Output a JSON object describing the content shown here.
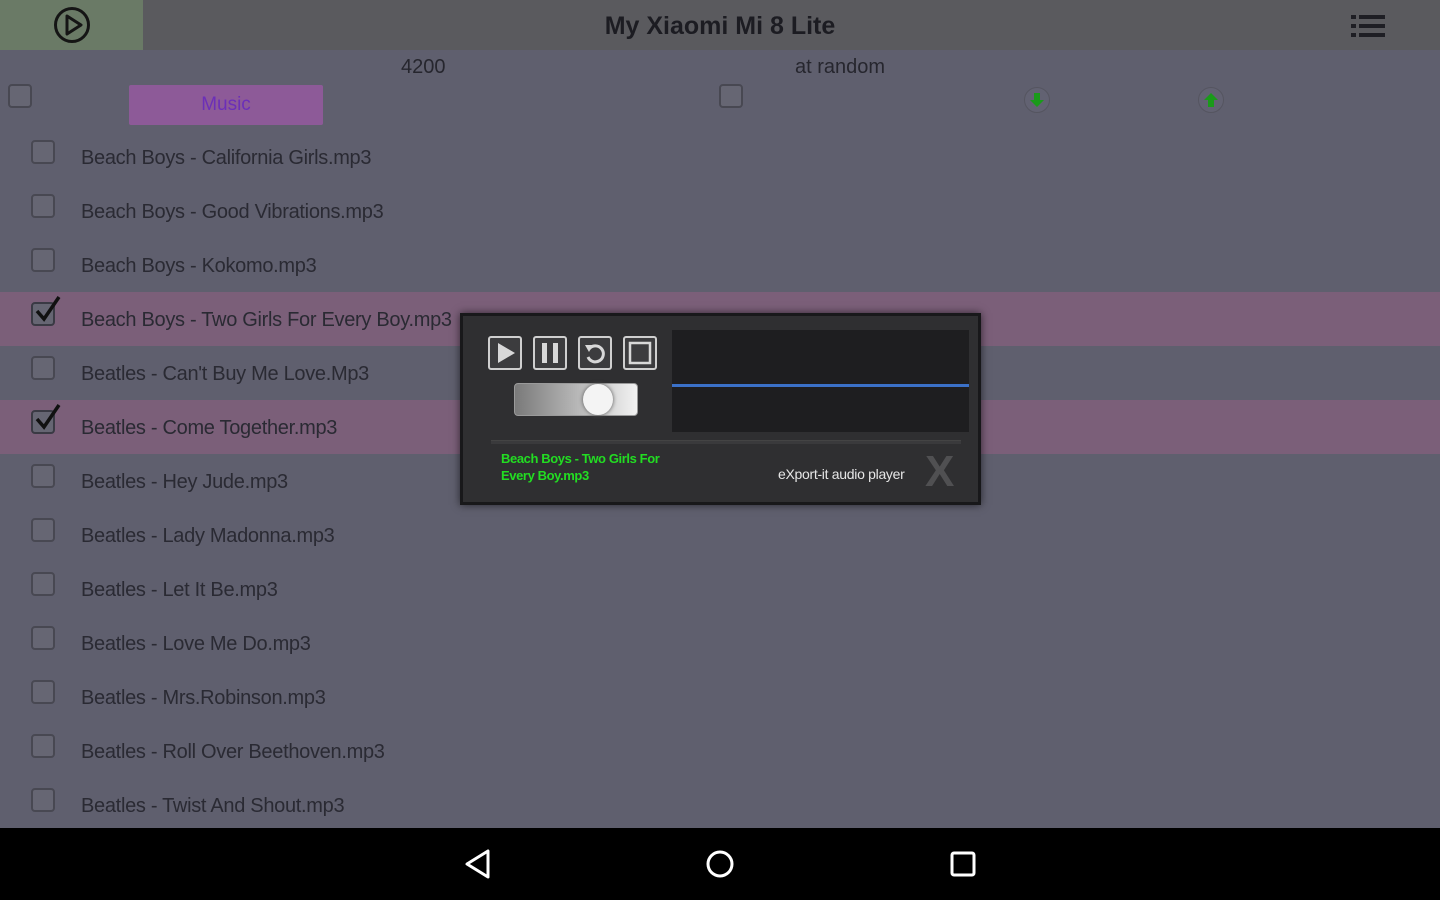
{
  "header": {
    "title": "My Xiaomi Mi 8 Lite"
  },
  "toolbar": {
    "count": "4200",
    "order_label": "at random",
    "music_label": "Music"
  },
  "tracks": [
    {
      "label": "Beach Boys - California Girls.mp3",
      "checked": false
    },
    {
      "label": "Beach Boys - Good Vibrations.mp3",
      "checked": false
    },
    {
      "label": "Beach Boys - Kokomo.mp3",
      "checked": false
    },
    {
      "label": "Beach Boys - Two Girls For Every Boy.mp3",
      "checked": true
    },
    {
      "label": "Beatles - Can't Buy Me Love.Mp3",
      "checked": false
    },
    {
      "label": "Beatles - Come Together.mp3",
      "checked": true
    },
    {
      "label": "Beatles - Hey Jude.mp3",
      "checked": false
    },
    {
      "label": "Beatles - Lady Madonna.mp3",
      "checked": false
    },
    {
      "label": "Beatles - Let It Be.mp3",
      "checked": false
    },
    {
      "label": "Beatles - Love Me Do.mp3",
      "checked": false
    },
    {
      "label": "Beatles - Mrs.Robinson.mp3",
      "checked": false
    },
    {
      "label": "Beatles - Roll Over Beethoven.mp3",
      "checked": false
    },
    {
      "label": "Beatles - Twist And Shout.mp3",
      "checked": false
    }
  ],
  "player": {
    "now_playing": "Beach Boys - Two Girls For Every Boy.mp3",
    "brand": "eXport-it audio player",
    "volume": 0.62
  },
  "colors": {
    "accent": "#8d5a98",
    "selected_row": "#7b5f79",
    "track_text": "#22dd22",
    "arrow": "#1a9a1a"
  },
  "icons": {
    "header_play": "play-circle-icon",
    "menu": "list-icon",
    "down": "arrow-down-icon",
    "up": "arrow-up-icon",
    "back": "back-icon",
    "home": "home-icon",
    "recents": "recents-icon"
  }
}
